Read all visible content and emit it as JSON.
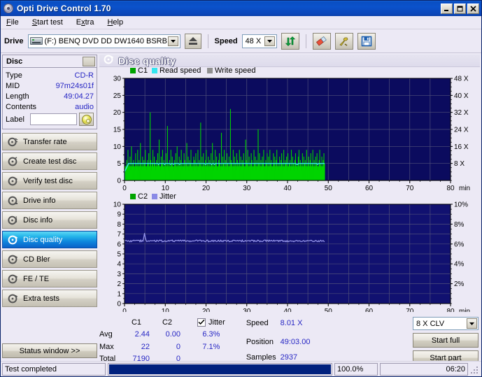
{
  "window": {
    "title": "Opti Drive Control 1.70",
    "icon": "disc-icon",
    "buttons": {
      "minimize": "_",
      "maximize": "□",
      "close": "✕"
    }
  },
  "menu": [
    {
      "label": "File",
      "accel": "F"
    },
    {
      "label": "Start test",
      "accel": "S"
    },
    {
      "label": "Extra",
      "accel": "x"
    },
    {
      "label": "Help",
      "accel": "H"
    }
  ],
  "toolbar": {
    "drive_label": "Drive",
    "drive_value": "(F:)   BENQ DVD DD DW1640 BSRB",
    "speed_label": "Speed",
    "speed_value": "48 X",
    "refresh_icon": "refresh-arrows-icon",
    "erase_icon": "eraser-icon",
    "tools_icon": "tools-icon",
    "save_icon": "save-disk-icon"
  },
  "disc": {
    "header": "Disc",
    "rows": [
      {
        "key": "Type",
        "value": "CD-R"
      },
      {
        "key": "MID",
        "value": "97m24s01f"
      },
      {
        "key": "Length",
        "value": "49:04.27"
      },
      {
        "key": "Contents",
        "value": "audio"
      }
    ],
    "label_key": "Label",
    "label_value": ""
  },
  "sidebar": {
    "items": [
      {
        "label": "Transfer rate",
        "icon": "disc-transfer-icon",
        "selected": false
      },
      {
        "label": "Create test disc",
        "icon": "disc-create-icon",
        "selected": false
      },
      {
        "label": "Verify test disc",
        "icon": "disc-verify-icon",
        "selected": false
      },
      {
        "label": "Drive info",
        "icon": "disc-drive-icon",
        "selected": false
      },
      {
        "label": "Disc info",
        "icon": "disc-info-icon",
        "selected": false
      },
      {
        "label": "Disc quality",
        "icon": "disc-quality-icon",
        "selected": true
      },
      {
        "label": "CD Bler",
        "icon": "disc-bler-icon",
        "selected": false
      },
      {
        "label": "FE / TE",
        "icon": "disc-fete-icon",
        "selected": false
      },
      {
        "label": "Extra tests",
        "icon": "disc-extra-icon",
        "selected": false
      }
    ],
    "status_window_button": "Status window >>"
  },
  "main": {
    "panel_title": "Disc quality",
    "panel_icon": "disc-quality-icon"
  },
  "chart_data": [
    {
      "type": "line",
      "name": "c1-chart",
      "title": "Disc quality",
      "legend": [
        {
          "label": "C1",
          "color": "#00a400"
        },
        {
          "label": "Read speed",
          "color": "#35e6f0"
        },
        {
          "label": "Write speed",
          "color": "#909090"
        }
      ],
      "legend_position": "top-left",
      "grid": true,
      "bg_color": "#0b0b5e",
      "xlabel": "min",
      "x_ticks": [
        "0",
        "10",
        "20",
        "30",
        "40",
        "50",
        "60",
        "70",
        "80"
      ],
      "xlim": [
        0,
        80
      ],
      "ylabel": "",
      "y_ticks": [
        "0",
        "5",
        "10",
        "15",
        "20",
        "25",
        "30"
      ],
      "ylim": [
        0,
        30
      ],
      "y2_ticks": [
        "8 X",
        "16 X",
        "24 X",
        "32 X",
        "40 X",
        "48 X"
      ],
      "y2lim": [
        0,
        48
      ],
      "series": [
        {
          "name": "C1",
          "color": "#00d400",
          "render": "bars",
          "x_end": 49.1,
          "baseline": 4.2,
          "values": [
            5,
            4,
            3,
            6,
            4,
            9,
            5,
            4,
            7,
            3,
            10,
            4,
            5,
            6,
            4,
            3,
            8,
            5,
            4,
            9,
            3,
            6,
            4,
            11,
            5,
            3,
            7,
            4,
            6,
            5,
            9,
            4,
            3,
            6,
            5,
            8,
            4,
            20,
            6,
            3,
            5,
            9,
            4,
            7,
            5,
            3,
            6,
            4,
            8,
            5,
            12,
            4,
            3,
            7,
            5,
            9,
            4,
            6,
            3,
            5,
            8,
            4,
            16,
            5,
            3,
            6,
            4,
            9,
            5,
            7,
            4,
            3,
            6,
            5,
            8,
            4,
            10,
            3,
            5,
            7,
            4,
            6,
            9,
            3,
            5,
            4,
            8,
            6,
            3,
            5,
            11,
            4,
            7,
            3,
            6,
            5,
            9,
            4,
            5,
            3,
            7,
            6,
            4,
            8,
            5,
            3,
            9,
            4,
            6,
            5,
            17,
            3,
            7,
            4,
            8,
            5,
            3,
            6,
            9,
            4,
            5,
            7,
            3,
            6,
            4,
            8,
            5,
            11,
            3,
            6,
            4,
            9,
            5,
            7,
            3,
            4,
            6,
            8,
            5,
            3,
            14,
            4,
            7,
            5,
            9,
            3,
            6,
            4,
            8,
            5,
            3,
            7,
            4,
            21,
            6,
            5,
            3,
            9,
            4,
            7,
            5,
            3,
            8,
            6,
            4,
            5,
            9,
            3,
            7,
            4,
            6,
            5,
            8,
            3,
            4,
            12,
            6,
            5,
            9,
            3,
            7,
            4,
            5,
            8,
            6,
            3,
            4,
            9,
            5,
            7,
            3,
            6,
            4,
            15,
            5,
            8,
            3,
            6,
            4,
            7,
            5,
            9,
            3,
            4,
            6,
            5,
            8,
            3,
            7,
            4,
            9,
            5,
            6,
            3,
            4,
            8,
            5,
            7,
            3,
            6,
            9,
            4,
            5,
            3,
            7,
            4,
            6,
            8,
            5,
            3,
            9,
            4,
            6,
            5,
            7,
            3,
            8,
            4,
            5,
            6,
            3,
            9,
            4,
            7,
            5,
            3,
            6,
            8,
            4,
            5,
            3,
            7,
            9,
            4,
            6,
            5,
            3,
            8,
            4,
            7,
            5,
            6,
            3,
            9,
            4,
            5,
            7,
            3,
            6,
            8,
            4,
            5,
            9,
            3,
            6,
            4,
            7,
            5,
            8,
            3,
            4,
            6,
            9,
            5,
            3,
            7,
            4,
            6,
            8,
            5
          ]
        },
        {
          "name": "Read speed",
          "color": "#35e6f0",
          "render": "line",
          "constant_value_y1": 5.0,
          "x_end": 49.1
        }
      ]
    },
    {
      "type": "line",
      "name": "c2-jitter-chart",
      "legend": [
        {
          "label": "C2",
          "color": "#00a400"
        },
        {
          "label": "Jitter",
          "color": "#8a8ae6"
        }
      ],
      "legend_position": "top-left",
      "grid": true,
      "bg_color": "#111170",
      "xlabel": "min",
      "x_ticks": [
        "0",
        "10",
        "20",
        "30",
        "40",
        "50",
        "60",
        "70",
        "80"
      ],
      "xlim": [
        0,
        80
      ],
      "y_ticks": [
        "0",
        "1",
        "2",
        "3",
        "4",
        "5",
        "6",
        "7",
        "8",
        "9",
        "10"
      ],
      "ylim": [
        0,
        10
      ],
      "y2_ticks": [
        "2%",
        "4%",
        "6%",
        "8%",
        "10%"
      ],
      "y2lim": [
        0,
        10
      ],
      "series": [
        {
          "name": "C2",
          "color": "#00d400",
          "render": "bars",
          "values": [],
          "x_end": 49.1
        },
        {
          "name": "Jitter",
          "color": "#9a9af0",
          "render": "line",
          "average": 6.3,
          "max": 7.1,
          "x_end": 49.1
        }
      ]
    }
  ],
  "stats": {
    "columns": [
      "C1",
      "C2"
    ],
    "jitter_label": "Jitter",
    "jitter_checked": true,
    "rows": [
      {
        "label": "Avg",
        "c1": "2.44",
        "c2": "0.00",
        "jitter": "6.3%"
      },
      {
        "label": "Max",
        "c1": "22",
        "c2": "0",
        "jitter": "7.1%"
      },
      {
        "label": "Total",
        "c1": "7190",
        "c2": "0",
        "jitter": ""
      }
    ]
  },
  "runinfo": [
    {
      "key": "Speed",
      "value": "8.01 X"
    },
    {
      "key": "Position",
      "value": "49:03.00"
    },
    {
      "key": "Samples",
      "value": "2937"
    }
  ],
  "controls": {
    "speed_mode": "8 X CLV",
    "start_full": "Start full",
    "start_part": "Start part"
  },
  "statusbar": {
    "message": "Test completed",
    "progress_percent": 100.0,
    "progress_text": "100.0%",
    "elapsed": "06:20"
  }
}
